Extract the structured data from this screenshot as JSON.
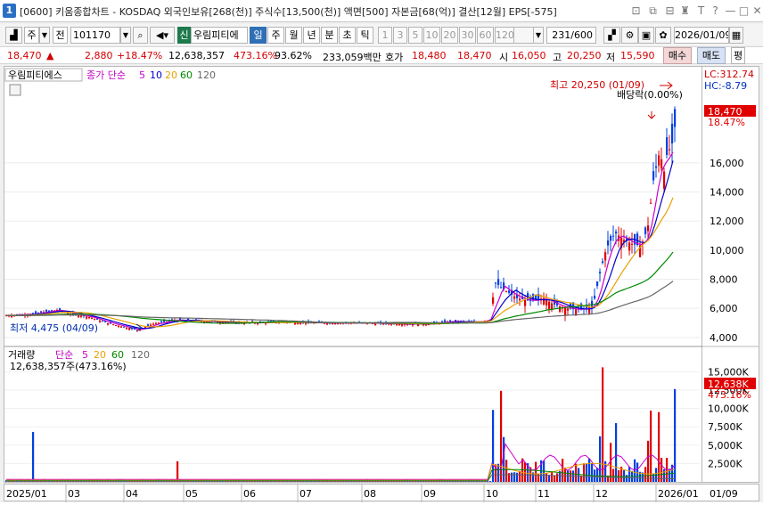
{
  "window": {
    "icon_label": "1",
    "title": "[0600] 키움종합차트 - KOSDAQ 외국인보유[268(천)] 주식수[13,500(천)] 액면[500] 자본금[68(억)] 결산[12월] EPS[-575]"
  },
  "toolbar": {
    "period_label": "주",
    "all_label": "전",
    "code_value": "101170",
    "market_badge": "신",
    "stock_name": "우림피티에",
    "timeframes": [
      "일",
      "주",
      "월",
      "년",
      "분",
      "초",
      "틱"
    ],
    "intervals": [
      "1",
      "3",
      "5",
      "10",
      "20",
      "30",
      "60",
      "120"
    ],
    "count_value": "231/600",
    "date_value": "2026/01/09"
  },
  "quote": {
    "price": "18,470",
    "change": "2,880",
    "change_pct": "+18.47%",
    "volume": "12,638,357",
    "volume_pct": "473.16%",
    "rotation": "93.62%",
    "amount": "233,059백만",
    "ask_label": "호가",
    "ask1": "18,480",
    "ask2": "18,470",
    "open_label": "시",
    "open": "16,050",
    "high_label": "고",
    "high": "20,250",
    "low_label": "저",
    "low": "15,590",
    "buy_label": "매수",
    "sell_label": "매도",
    "eval_label": "평"
  },
  "price_panel": {
    "legend_name": "우림피티에스",
    "legend_ma": "종가 단순",
    "ma_periods": [
      "5",
      "10",
      "20",
      "60",
      "120"
    ],
    "ma_colors": [
      "#cc00cc",
      "#0000cc",
      "#e8a000",
      "#008800",
      "#666666"
    ],
    "high_annot": "최고 20,250 (01/09)",
    "dividend_annot": "배당락(0.00%)",
    "low_annot": "최저 4,475 (04/09)",
    "lc": "LC:312.74",
    "hc": "HC:-8.79",
    "current_tag": "18,470",
    "current_pct": "18.47%"
  },
  "volume_panel": {
    "legend_name": "거래량",
    "legend_ma": "단순",
    "ma_periods": [
      "5",
      "20",
      "60",
      "120"
    ],
    "ma_colors": [
      "#cc00cc",
      "#e8a000",
      "#008800",
      "#666666"
    ],
    "info": "12,638,357주(473.16%)",
    "current_tag": "12,638K",
    "current_pct": "473.16%"
  },
  "colors": {
    "up": "#e00000",
    "down": "#0040e0",
    "accent": "#2f6fb5"
  },
  "chart_data": [
    {
      "type": "candlestick",
      "title": "우림피티에스 일봉",
      "x_dates": [
        "2025/01",
        "03",
        "04",
        "05",
        "06",
        "07",
        "08",
        "09",
        "10",
        "11",
        "12",
        "2026/01",
        "01/09"
      ],
      "ylim": [
        3500,
        21500
      ],
      "y_ticks": [
        "4,000",
        "6,000",
        "8,000",
        "10,000",
        "12,000",
        "14,000",
        "16,000"
      ],
      "y_tick_values": [
        4000,
        6000,
        8000,
        10000,
        12000,
        14000,
        16000
      ],
      "series": [
        {
          "name": "종가",
          "close_path": [
            [
              0,
              5500
            ],
            [
              30,
              5600
            ],
            [
              60,
              5900
            ],
            [
              75,
              5600
            ],
            [
              95,
              5400
            ],
            [
              115,
              5000
            ],
            [
              135,
              4700
            ],
            [
              150,
              4500
            ],
            [
              165,
              4900
            ],
            [
              190,
              5200
            ],
            [
              230,
              5100
            ],
            [
              270,
              5000
            ],
            [
              310,
              5050
            ],
            [
              350,
              5000
            ],
            [
              390,
              5000
            ],
            [
              430,
              4950
            ],
            [
              470,
              4900
            ],
            [
              500,
              5100
            ],
            [
              530,
              5050
            ],
            [
              545,
              5200
            ],
            [
              550,
              7800
            ],
            [
              560,
              7300
            ],
            [
              575,
              6700
            ],
            [
              590,
              6500
            ],
            [
              605,
              6700
            ],
            [
              615,
              6300
            ],
            [
              630,
              6000
            ],
            [
              645,
              5900
            ],
            [
              660,
              6100
            ],
            [
              668,
              8400
            ],
            [
              675,
              10100
            ],
            [
              685,
              11200
            ],
            [
              695,
              10700
            ],
            [
              705,
              10400
            ],
            [
              715,
              10300
            ],
            [
              722,
              11700
            ],
            [
              728,
              14800
            ],
            [
              735,
              16800
            ],
            [
              740,
              15400
            ],
            [
              745,
              17300
            ],
            [
              748,
              16200
            ],
            [
              750,
              18470
            ]
          ]
        },
        {
          "name": "최고",
          "value": 20250,
          "date": "01/09"
        },
        {
          "name": "최저",
          "value": 4475,
          "date": "04/09"
        }
      ]
    },
    {
      "type": "bar",
      "title": "거래량",
      "ylim": [
        0,
        16500000
      ],
      "y_ticks": [
        "2,500K",
        "5,000K",
        "7,500K",
        "10,000K",
        "12,500K",
        "15,000K"
      ],
      "y_tick_values": [
        2500000,
        5000000,
        7500000,
        10000000,
        12500000,
        15000000
      ],
      "last_value": 12638357
    }
  ]
}
